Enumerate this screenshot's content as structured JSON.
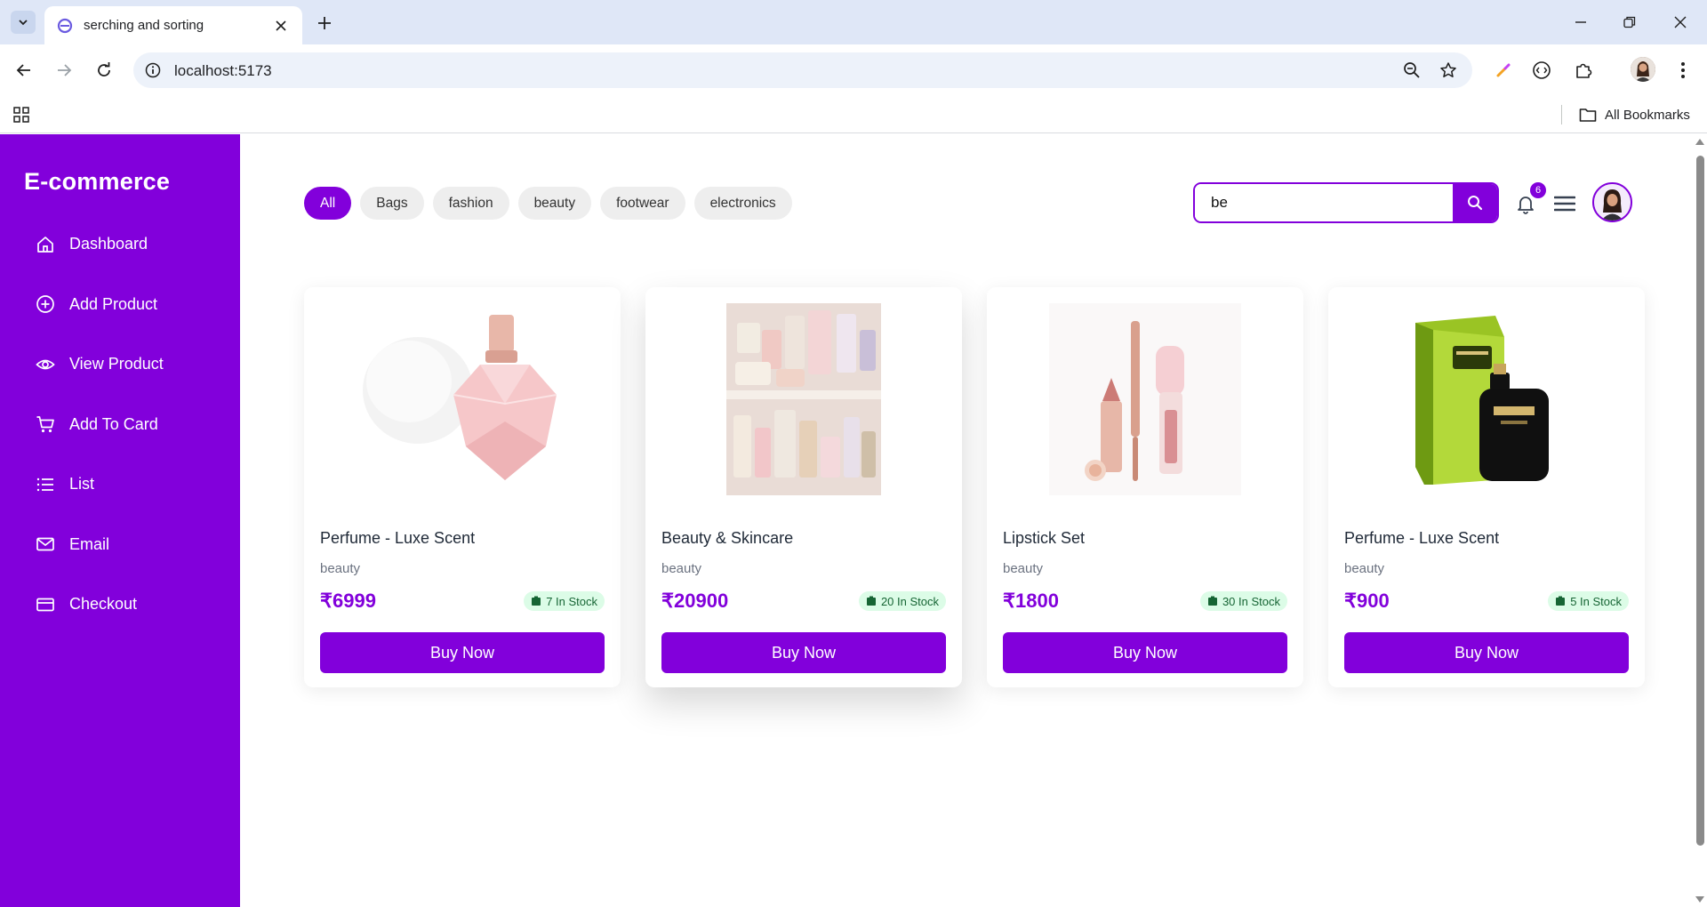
{
  "browser": {
    "tab_title": "serching and sorting",
    "url": "localhost:5173",
    "bookmarks_label": "All Bookmarks"
  },
  "app": {
    "brand": "E-commerce",
    "accent_color": "#8200db",
    "nav": [
      {
        "label": "Dashboard",
        "icon": "home-icon"
      },
      {
        "label": "Add Product",
        "icon": "plus-circle-icon"
      },
      {
        "label": "View Product",
        "icon": "eye-icon"
      },
      {
        "label": "Add To Card",
        "icon": "cart-icon"
      },
      {
        "label": "List",
        "icon": "list-icon"
      },
      {
        "label": "Email",
        "icon": "mail-icon"
      },
      {
        "label": "Checkout",
        "icon": "credit-card-icon"
      }
    ],
    "filters": [
      {
        "label": "All",
        "active": true
      },
      {
        "label": "Bags",
        "active": false
      },
      {
        "label": "fashion",
        "active": false
      },
      {
        "label": "beauty",
        "active": false
      },
      {
        "label": "footwear",
        "active": false
      },
      {
        "label": "electronics",
        "active": false
      }
    ],
    "search": {
      "value": "be",
      "placeholder": ""
    },
    "notifications": {
      "count": "6"
    },
    "products": [
      {
        "name": "Perfume - Luxe Scent",
        "category": "beauty",
        "price": "₹6999",
        "stock": "7 In Stock",
        "cta": "Buy Now",
        "image": "pink-perfume-bottle"
      },
      {
        "name": "Beauty & Skincare",
        "category": "beauty",
        "price": "₹20900",
        "stock": "20 In Stock",
        "cta": "Buy Now",
        "image": "skincare-shelves"
      },
      {
        "name": "Lipstick Set",
        "category": "beauty",
        "price": "₹1800",
        "stock": "30 In Stock",
        "cta": "Buy Now",
        "image": "lipstick-set"
      },
      {
        "name": "Perfume - Luxe Scent",
        "category": "beauty",
        "price": "₹900",
        "stock": "5 In Stock",
        "cta": "Buy Now",
        "image": "green-box-perfume"
      }
    ]
  }
}
